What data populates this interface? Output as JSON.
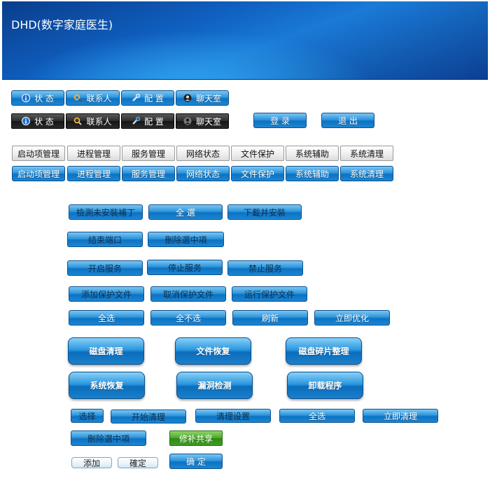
{
  "banner": {
    "title": "DHD(数字家庭医生)"
  },
  "nav_blue": [
    {
      "label": "状 态",
      "icon": "info-icon"
    },
    {
      "label": "联系人",
      "icon": "search-icon"
    },
    {
      "label": "配 置",
      "icon": "wrench-icon"
    },
    {
      "label": "聊天室",
      "icon": "chat-person-icon"
    }
  ],
  "nav_dark": [
    {
      "label": "状 态",
      "icon": "info-icon"
    },
    {
      "label": "联系人",
      "icon": "search-icon"
    },
    {
      "label": "配 置",
      "icon": "wrench-icon"
    },
    {
      "label": "聊天室",
      "icon": "chat-person-icon"
    }
  ],
  "auth": {
    "login": "登 录",
    "logout": "退 出"
  },
  "tabs_gray": [
    "启动项管理",
    "进程管理",
    "服务管理",
    "网络状态",
    "文件保护",
    "系统辅助",
    "系统清理"
  ],
  "tabs_blue": [
    "启动项管理",
    "进程管理",
    "服务管理",
    "网络状态",
    "文件保护",
    "系统辅助",
    "系统清理"
  ],
  "patch_row": {
    "detect": "檢測未安裝補丁",
    "select_all": "全 選",
    "download": "下載并安裝"
  },
  "port_row": {
    "end_port": "结束端口",
    "delete_selected": "刪除選中項"
  },
  "service_row": {
    "start": "开启服务",
    "stop": "停止服务",
    "disable": "禁止服务"
  },
  "protect_row": {
    "add": "添加保护文件",
    "cancel": "取消保护文件",
    "run": "运行保护文件"
  },
  "select_row": {
    "all": "全选",
    "none": "全不选",
    "refresh": "刷新",
    "optimize": "立即优化"
  },
  "big_row1": {
    "disk_clean": "磁盘清理",
    "file_recover": "文件恢复",
    "defrag": "磁盘碎片整理"
  },
  "big_row2": {
    "sys_recover": "系统恢复",
    "vuln_scan": "漏洞检测",
    "uninstall": "卸载程序"
  },
  "clean_row": {
    "choose": "选择",
    "start_clean": "开始清理",
    "clean_settings": "清理设置",
    "select_all": "全选",
    "clean_now": "立即清理"
  },
  "misc_row": {
    "delete_selected": "刪除選中項",
    "repair_share": "修补共享"
  },
  "bottom_row": {
    "add": "添加",
    "confirm": "確定",
    "ok": "确 定"
  }
}
